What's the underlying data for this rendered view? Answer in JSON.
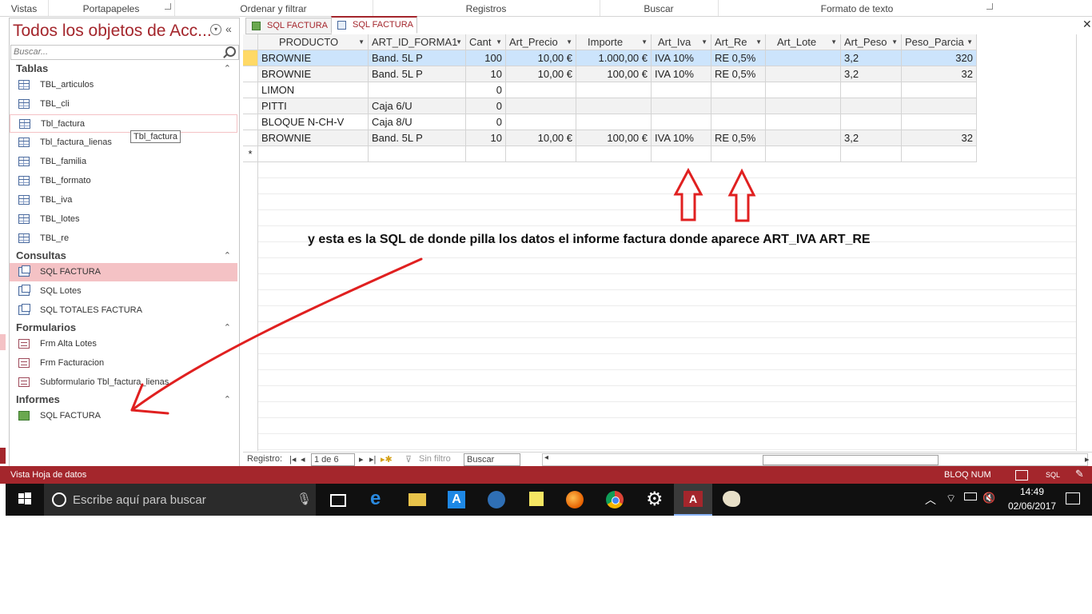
{
  "ribbon": {
    "groups": [
      "Vistas",
      "Portapapeles",
      "Ordenar y filtrar",
      "Registros",
      "Buscar",
      "Formato de texto"
    ]
  },
  "nav": {
    "title": "Todos los objetos de Acc...",
    "search_placeholder": "Buscar...",
    "groups": {
      "tablas": "Tablas",
      "consultas": "Consultas",
      "formularios": "Formularios",
      "informes": "Informes"
    },
    "tables": [
      "TBL_articulos",
      "TBL_cli",
      "Tbl_factura",
      "Tbl_factura_lienas",
      "TBL_familia",
      "TBL_formato",
      "TBL_iva",
      "TBL_lotes",
      "TBL_re"
    ],
    "queries": [
      "SQL FACTURA",
      "SQL Lotes",
      "SQL TOTALES FACTURA"
    ],
    "forms": [
      "Frm Alta Lotes",
      "Frm Facturacion",
      "Subformulario Tbl_factura_lienas"
    ],
    "reports": [
      "SQL FACTURA"
    ],
    "tooltip": "Tbl_factura"
  },
  "tabs": [
    "SQL FACTURA",
    "SQL FACTURA"
  ],
  "grid": {
    "columns": [
      "PRODUCTO",
      "ART_ID_FORMA1",
      "Cant",
      "Art_Precio",
      "Importe",
      "Art_Iva",
      "Art_Re",
      "Art_Lote",
      "Art_Peso",
      "Peso_Parcia"
    ],
    "rows": [
      [
        "BROWNIE",
        "Band. 5L P",
        "100",
        "10,00 €",
        "1.000,00 €",
        "IVA 10%",
        "RE 0,5%",
        "",
        "3,2",
        "320"
      ],
      [
        "BROWNIE",
        "Band. 5L P",
        "10",
        "10,00 €",
        "100,00 €",
        "IVA 10%",
        "RE 0,5%",
        "",
        "3,2",
        "32"
      ],
      [
        "LIMON",
        "",
        "0",
        "",
        "",
        "",
        "",
        "",
        "",
        ""
      ],
      [
        "PITTI",
        "Caja 6/U",
        "0",
        "",
        "",
        "",
        "",
        "",
        "",
        ""
      ],
      [
        "BLOQUE N-CH-V",
        "Caja 8/U",
        "0",
        "",
        "",
        "",
        "",
        "",
        "",
        ""
      ],
      [
        "BROWNIE",
        "Band. 5L P",
        "10",
        "10,00 €",
        "100,00 €",
        "IVA 10%",
        "RE 0,5%",
        "",
        "3,2",
        "32"
      ]
    ],
    "new_row_marker": "*"
  },
  "recnav": {
    "label": "Registro:",
    "position": "1 de 6",
    "filter": "Sin filtro",
    "search": "Buscar"
  },
  "status": {
    "left": "Vista Hoja de datos",
    "numlock": "BLOQ NUM",
    "sql": "SQL"
  },
  "taskbar": {
    "search_placeholder": "Escribe aquí para buscar",
    "time": "14:49",
    "date": "02/06/2017"
  },
  "annotation": {
    "text": "y esta es la SQL de donde pilla los datos el informe factura donde aparece ART_IVA ART_RE",
    "color": "#e02020"
  },
  "colors": {
    "accent": "#a4262c",
    "selection": "#cce4fc",
    "nav_selected": "#f4c2c5"
  }
}
